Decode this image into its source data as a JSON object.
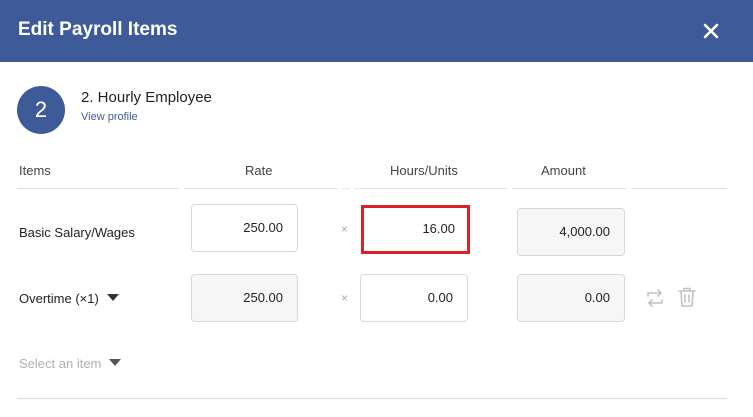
{
  "header": {
    "title": "Edit Payroll Items"
  },
  "employee": {
    "avatar_number": "2",
    "name": "2. Hourly Employee",
    "view_profile_label": "View profile"
  },
  "columns": {
    "items": "Items",
    "rate": "Rate",
    "hours_units": "Hours/Units",
    "amount": "Amount"
  },
  "rows": [
    {
      "label": "Basic Salary/Wages",
      "rate": "250.00",
      "multiplier": "×",
      "hours": "16.00",
      "amount": "4,000.00"
    },
    {
      "label": "Overtime (×1)",
      "rate": "250.00",
      "multiplier": "×",
      "hours": "0.00",
      "amount": "0.00"
    }
  ],
  "select_item": {
    "placeholder": "Select an item"
  },
  "icons": [
    "close-icon",
    "caret-down-icon",
    "swap-icon",
    "trash-icon"
  ],
  "colors": {
    "header_bg": "#3f5a99",
    "highlight_border": "#d9222a"
  }
}
